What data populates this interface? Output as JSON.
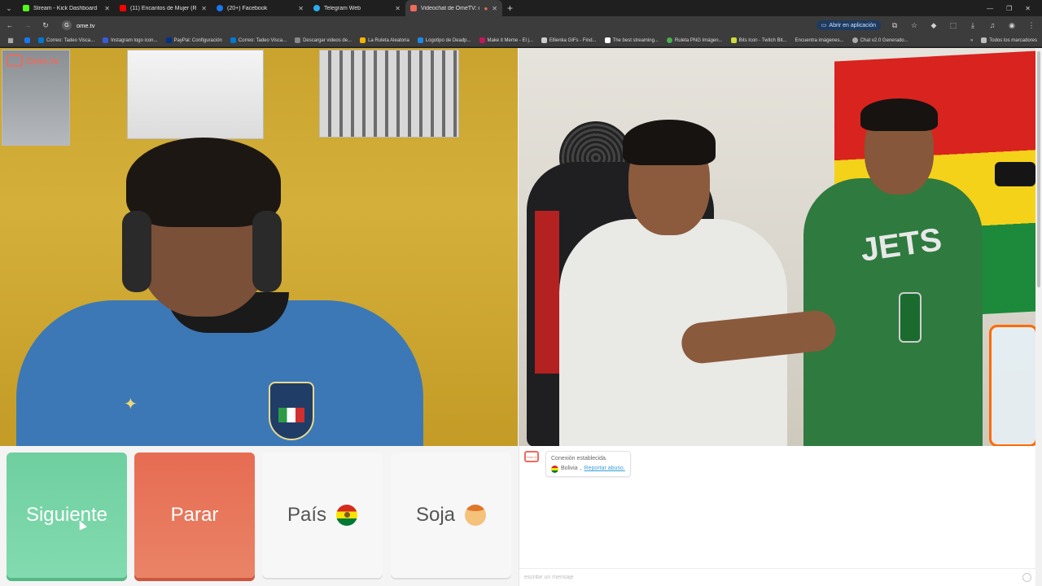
{
  "browser": {
    "tabs": [
      {
        "title": "Stream - Kick Dashboard",
        "color": "#53fc18"
      },
      {
        "title": "(11) Encantos de Mujer (Radio",
        "color": "#ff0000"
      },
      {
        "title": "(20+) Facebook",
        "color": "#1877f2"
      },
      {
        "title": "Telegram Web",
        "color": "#2aabee"
      },
      {
        "title": "Videochat de OmeTV: uno",
        "color": "#ee6b5d"
      }
    ],
    "new_tab": "+",
    "url": "ome.tv",
    "open_app_label": "Abrir en aplicación",
    "bookmarks": [
      {
        "label": "Correo: Tadeo Visca...",
        "color": "#0078d4"
      },
      {
        "label": "Instagram logo icon...",
        "color": "#3b5bdb"
      },
      {
        "label": "PayPal: Configuración",
        "color": "#003087"
      },
      {
        "label": "Correo: Tadeo Visca...",
        "color": "#0078d4"
      },
      {
        "label": "Descargar videos de...",
        "color": "#888888"
      },
      {
        "label": "La Ruleta Aleatoria",
        "color": "#f4b400"
      },
      {
        "label": "Logotipo de Deadp...",
        "color": "#1e88e5"
      },
      {
        "label": "Make it Meme - El j...",
        "color": "#c2185b"
      },
      {
        "label": "Ellienka GIFs - Find...",
        "color": "#cccccc"
      },
      {
        "label": "The best streaming...",
        "color": "#ffffff"
      },
      {
        "label": "Ruleta PNG Imágen...",
        "color": "#4caf50"
      },
      {
        "label": "Bits Icon - Twitch Bit...",
        "color": "#cddc39"
      },
      {
        "label": "Encuentra imágenes...",
        "color": "#777777"
      },
      {
        "label": "Chat v2.0 Generado...",
        "color": "#aaaaaa"
      }
    ],
    "bookmarks_more": "»",
    "all_bookmarks_label": "Todos los marcadores"
  },
  "app": {
    "logo_text": "Ome.tv",
    "logo_small": "Ome tv",
    "buttons": {
      "next": "Siguiente",
      "stop": "Parar",
      "country": "País",
      "gender": "Soja"
    }
  },
  "chat": {
    "status": "Conexión establecida.",
    "country": "Bolivia",
    "separator": ",",
    "report_label": "Reportar abuso.",
    "input_placeholder": "escribir un mensaje"
  },
  "video": {
    "left_poster_text": "",
    "right_shirt_print": "JETS"
  }
}
